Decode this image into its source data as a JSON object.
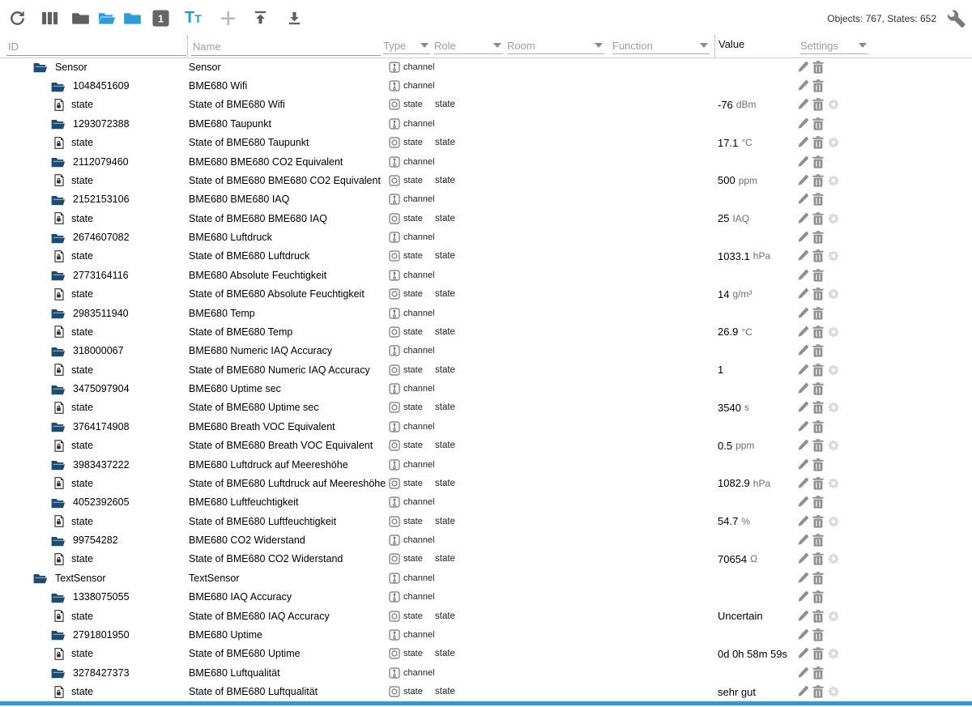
{
  "statusbar": {
    "objects_counter": "Objects: 767, States: 652"
  },
  "toolbar": {
    "icons": [
      "refresh-icon",
      "columns-icon",
      "folder-closed-icon",
      "folder-open-icon",
      "folder-closed-blue-icon",
      "expand-level-1-icon",
      "text-size-icon",
      "add-icon",
      "upload-icon",
      "download-icon",
      "wrench-icon"
    ],
    "expand_level_label": "1",
    "text_icon_label_big": "T",
    "text_icon_label_small": "T"
  },
  "columns": {
    "id_placeholder": "ID",
    "name_placeholder": "Name",
    "type_label": "Type",
    "role_label": "Role",
    "room_label": "Room",
    "function_label": "Function",
    "value_label": "Value",
    "settings_label": "Settings"
  },
  "colors": {
    "accent_blue": "#2499d9",
    "tree_folder_navy": "#1c4a70",
    "bottom_bar_blue": "#3498cb",
    "icon_gray": "#5f5f5f",
    "action_gray": "#8f8f8f",
    "gear_light_gray": "#dcdcdc"
  },
  "rows": [
    {
      "indent": 1,
      "kind": "folder",
      "id": "Sensor",
      "name": "Sensor",
      "type": "channel",
      "role": "",
      "value": "",
      "unit": ""
    },
    {
      "indent": 2,
      "kind": "folder",
      "id": "1048451609",
      "name": "BME680 Wifi",
      "type": "channel",
      "role": "",
      "value": "",
      "unit": ""
    },
    {
      "indent": 3,
      "kind": "state",
      "id": "state",
      "name": "State of BME680 Wifi",
      "type": "state",
      "role": "state",
      "value": "-76",
      "unit": "dBm"
    },
    {
      "indent": 2,
      "kind": "folder",
      "id": "1293072388",
      "name": "BME680 Taupunkt",
      "type": "channel",
      "role": "",
      "value": "",
      "unit": ""
    },
    {
      "indent": 3,
      "kind": "state",
      "id": "state",
      "name": "State of BME680 Taupunkt",
      "type": "state",
      "role": "state",
      "value": "17.1",
      "unit": "°C"
    },
    {
      "indent": 2,
      "kind": "folder",
      "id": "2112079460",
      "name": "BME680 BME680 CO2 Equivalent",
      "type": "channel",
      "role": "",
      "value": "",
      "unit": ""
    },
    {
      "indent": 3,
      "kind": "state",
      "id": "state",
      "name": "State of BME680 BME680 CO2 Equivalent",
      "type": "state",
      "role": "state",
      "value": "500",
      "unit": "ppm"
    },
    {
      "indent": 2,
      "kind": "folder",
      "id": "2152153106",
      "name": "BME680 BME680 IAQ",
      "type": "channel",
      "role": "",
      "value": "",
      "unit": ""
    },
    {
      "indent": 3,
      "kind": "state",
      "id": "state",
      "name": "State of BME680 BME680 IAQ",
      "type": "state",
      "role": "state",
      "value": "25",
      "unit": "IAQ"
    },
    {
      "indent": 2,
      "kind": "folder",
      "id": "2674607082",
      "name": "BME680 Luftdruck",
      "type": "channel",
      "role": "",
      "value": "",
      "unit": ""
    },
    {
      "indent": 3,
      "kind": "state",
      "id": "state",
      "name": "State of BME680 Luftdruck",
      "type": "state",
      "role": "state",
      "value": "1033.1",
      "unit": "hPa"
    },
    {
      "indent": 2,
      "kind": "folder",
      "id": "2773164116",
      "name": "BME680 Absolute Feuchtigkeit",
      "type": "channel",
      "role": "",
      "value": "",
      "unit": ""
    },
    {
      "indent": 3,
      "kind": "state",
      "id": "state",
      "name": "State of BME680 Absolute Feuchtigkeit",
      "type": "state",
      "role": "state",
      "value": "14",
      "unit": "g/m³"
    },
    {
      "indent": 2,
      "kind": "folder",
      "id": "2983511940",
      "name": "BME680 Temp",
      "type": "channel",
      "role": "",
      "value": "",
      "unit": ""
    },
    {
      "indent": 3,
      "kind": "state",
      "id": "state",
      "name": "State of BME680 Temp",
      "type": "state",
      "role": "state",
      "value": "26.9",
      "unit": "°C"
    },
    {
      "indent": 2,
      "kind": "folder",
      "id": "318000067",
      "name": "BME680 Numeric IAQ Accuracy",
      "type": "channel",
      "role": "",
      "value": "",
      "unit": ""
    },
    {
      "indent": 3,
      "kind": "state",
      "id": "state",
      "name": "State of BME680 Numeric IAQ Accuracy",
      "type": "state",
      "role": "state",
      "value": "1",
      "unit": ""
    },
    {
      "indent": 2,
      "kind": "folder",
      "id": "3475097904",
      "name": "BME680 Uptime sec",
      "type": "channel",
      "role": "",
      "value": "",
      "unit": ""
    },
    {
      "indent": 3,
      "kind": "state",
      "id": "state",
      "name": "State of BME680 Uptime sec",
      "type": "state",
      "role": "state",
      "value": "3540",
      "unit": "s"
    },
    {
      "indent": 2,
      "kind": "folder",
      "id": "3764174908",
      "name": "BME680 Breath VOC Equivalent",
      "type": "channel",
      "role": "",
      "value": "",
      "unit": ""
    },
    {
      "indent": 3,
      "kind": "state",
      "id": "state",
      "name": "State of BME680 Breath VOC Equivalent",
      "type": "state",
      "role": "state",
      "value": "0.5",
      "unit": "ppm"
    },
    {
      "indent": 2,
      "kind": "folder",
      "id": "3983437222",
      "name": "BME680 Luftdruck auf Meereshöhe",
      "type": "channel",
      "role": "",
      "value": "",
      "unit": ""
    },
    {
      "indent": 3,
      "kind": "state",
      "id": "state",
      "name": "State of BME680 Luftdruck auf Meereshöhe",
      "type": "state",
      "role": "state",
      "value": "1082.9",
      "unit": "hPa"
    },
    {
      "indent": 2,
      "kind": "folder",
      "id": "4052392605",
      "name": "BME680 Luftfeuchtigkeit",
      "type": "channel",
      "role": "",
      "value": "",
      "unit": ""
    },
    {
      "indent": 3,
      "kind": "state",
      "id": "state",
      "name": "State of BME680 Luftfeuchtigkeit",
      "type": "state",
      "role": "state",
      "value": "54.7",
      "unit": "%"
    },
    {
      "indent": 2,
      "kind": "folder",
      "id": "99754282",
      "name": "BME680 CO2 Widerstand",
      "type": "channel",
      "role": "",
      "value": "",
      "unit": ""
    },
    {
      "indent": 3,
      "kind": "state",
      "id": "state",
      "name": "State of BME680 CO2 Widerstand",
      "type": "state",
      "role": "state",
      "value": "70654",
      "unit": "Ω"
    },
    {
      "indent": 1,
      "kind": "folder",
      "id": "TextSensor",
      "name": "TextSensor",
      "type": "channel",
      "role": "",
      "value": "",
      "unit": ""
    },
    {
      "indent": 2,
      "kind": "folder",
      "id": "1338075055",
      "name": "BME680 IAQ Accuracy",
      "type": "channel",
      "role": "",
      "value": "",
      "unit": ""
    },
    {
      "indent": 3,
      "kind": "state",
      "id": "state",
      "name": "State of BME680 IAQ Accuracy",
      "type": "state",
      "role": "state",
      "value": "Uncertain",
      "unit": ""
    },
    {
      "indent": 2,
      "kind": "folder",
      "id": "2791801950",
      "name": "BME680 Uptime",
      "type": "channel",
      "role": "",
      "value": "",
      "unit": ""
    },
    {
      "indent": 3,
      "kind": "state",
      "id": "state",
      "name": "State of BME680 Uptime",
      "type": "state",
      "role": "state",
      "value": "0d 0h 58m 59s",
      "unit": ""
    },
    {
      "indent": 2,
      "kind": "folder",
      "id": "3278427373",
      "name": "BME680 Luftqualität",
      "type": "channel",
      "role": "",
      "value": "",
      "unit": ""
    },
    {
      "indent": 3,
      "kind": "state",
      "id": "state",
      "name": "State of BME680 Luftqualität",
      "type": "state",
      "role": "state",
      "value": "sehr gut",
      "unit": ""
    }
  ]
}
